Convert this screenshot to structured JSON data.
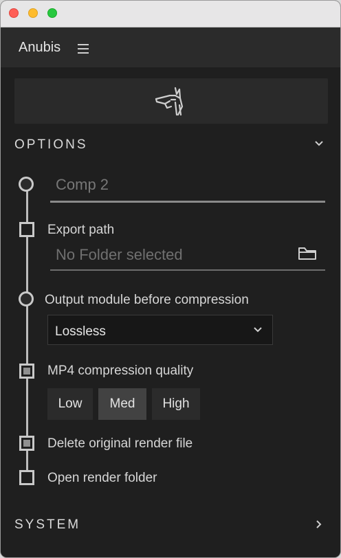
{
  "panel": {
    "title": "Anubis"
  },
  "sections": {
    "options": {
      "label": "OPTIONS"
    },
    "system": {
      "label": "SYSTEM"
    }
  },
  "comp": {
    "value": "Comp 2"
  },
  "export": {
    "label": "Export path",
    "placeholder": "No Folder selected"
  },
  "output_module": {
    "label": "Output module before compression",
    "selected": "Lossless"
  },
  "quality": {
    "label": "MP4 compression quality",
    "buttons": [
      "Low",
      "Med",
      "High"
    ],
    "selected": "Med"
  },
  "delete_original": {
    "label": "Delete original render file",
    "checked": true
  },
  "open_folder": {
    "label": "Open render folder",
    "checked": false
  },
  "colors": {
    "traffic_red": "#fe5f57",
    "traffic_yellow": "#febc2e",
    "traffic_green": "#28c840",
    "panel_bg": "#1f1f1f"
  },
  "icons": {
    "menu": "hamburger-icon",
    "logo": "anubis-logo",
    "folder": "folder-icon",
    "chevron_down": "chevron-down-icon",
    "chevron_right": "chevron-right-icon"
  }
}
